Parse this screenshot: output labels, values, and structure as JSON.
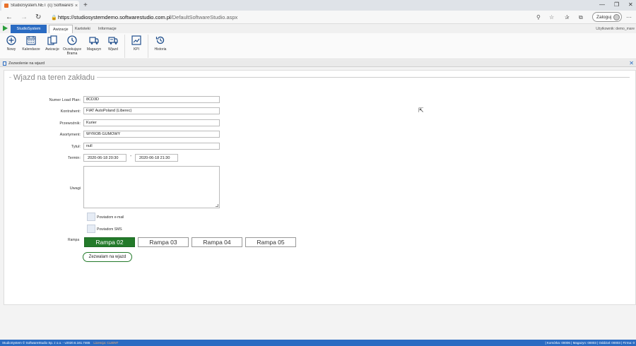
{
  "browser": {
    "tab_title": "StudioSystem.NET (c) SoftwareSt",
    "tab_close": "×",
    "new_tab": "+",
    "url_host": "https://studiosystemdemo.softwarestudio.com.pl",
    "url_path": "/DefaultSoftwareStudio.aspx",
    "login_label": "Zaloguj",
    "icons": [
      "back-arrow-icon",
      "forward-arrow-icon",
      "refresh-icon",
      "lock-icon",
      "zoom-icon",
      "star-icon",
      "favorites-icon",
      "collections-icon",
      "more-icon"
    ]
  },
  "app": {
    "brand_tab": "StudioSystem",
    "tabs": [
      "Awizacje",
      "Kartoteki",
      "Informacje"
    ],
    "user_label": "Użytkownik: demo_mare",
    "toolbar": [
      {
        "label": "Nowy"
      },
      {
        "label": "Kalendarze"
      },
      {
        "label": "Awizacje"
      },
      {
        "label": "Oczekujące Brama"
      },
      {
        "label": "Magazyn"
      },
      {
        "label": "Wjazd"
      },
      {
        "label": "KPI"
      },
      {
        "label": "Historia"
      }
    ],
    "page_label": "Zezwolenie na wjazd",
    "accent_color": "#2a6bc2"
  },
  "form": {
    "legend": "Wjazd na teren zakładu",
    "load_plan_label": "Numer Load Plan:",
    "load_plan_value": "8CD3D",
    "kontrahent_label": "Kontrahent:",
    "kontrahent_value": "FIAT AutoPoland (Liberec)",
    "przewoznik_label": "Przewoźnik:",
    "przewoznik_value": "Kurier",
    "asortyment_label": "Asortyment:",
    "asortyment_value": "WYROB GUMOWY",
    "tytul_label": "Tytuł:",
    "tytul_value": "null",
    "termin_label": "Termin:",
    "termin_from": "2020-06-18 20:30",
    "termin_sep": "-",
    "termin_to": "2020-06-18 21:30",
    "uwagi_label": "Uwagi",
    "notify_email": "Powiadom e-mail",
    "notify_sms": "Powiadom SMS",
    "rampa_label": "Rampa",
    "rampy": [
      "Rampa 02",
      "Rampa 03",
      "Rampa 04",
      "Rampa 05"
    ],
    "selected_rampa": "Rampa 02",
    "approve_label": "Zezwalam na wjazd",
    "selected_color": "#237a2a"
  },
  "status": {
    "left": "StudioSystem © SoftwareStudio Sp. z o.o. - v2020.6.161.7465",
    "license": "Licencja: CLIENT",
    "right": "| Komórka: 00006 | Magazyn: 00003 | Oddział: 00003 | Firma: 0"
  }
}
